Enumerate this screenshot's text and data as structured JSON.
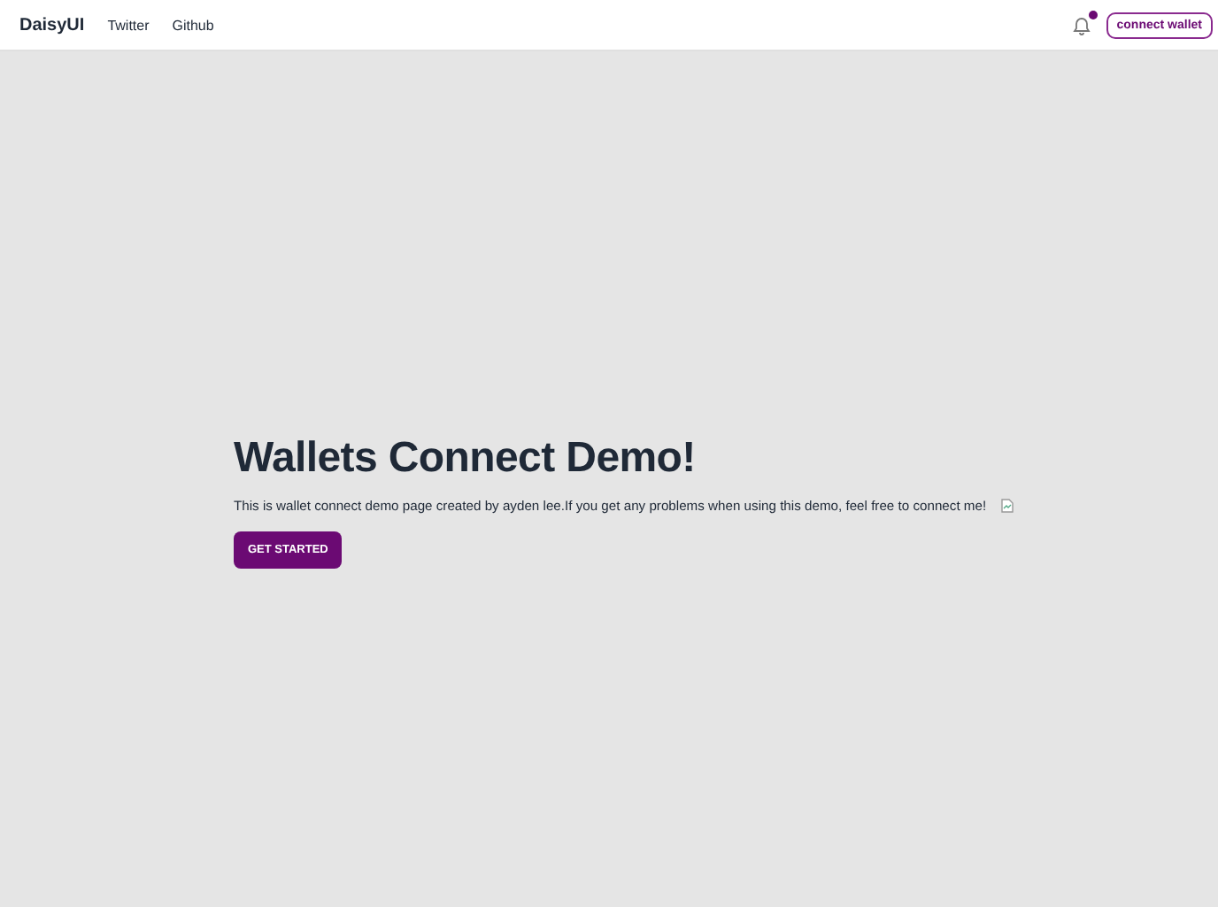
{
  "navbar": {
    "brand": "DaisyUI",
    "links": [
      "Twitter",
      "Github"
    ],
    "notifications": {
      "unread": true
    },
    "connect_button": "connect wallet"
  },
  "hero": {
    "title": "Wallets Connect Demo!",
    "text": "This is wallet connect demo page created by ayden lee.If you get any problems when using this demo, feel free to connect me!",
    "image": {
      "broken": true
    },
    "button": "GET STARTED"
  }
}
